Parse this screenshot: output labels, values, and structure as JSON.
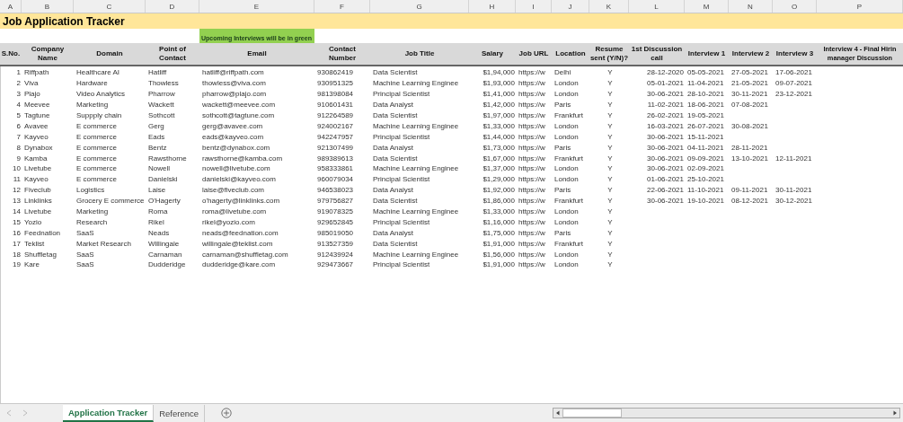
{
  "column_letters": [
    "A",
    "B",
    "C",
    "D",
    "E",
    "F",
    "G",
    "H",
    "I",
    "J",
    "K",
    "L",
    "M",
    "N",
    "O",
    "P"
  ],
  "title": "Job Application Tracker",
  "note": "Upcoming Interviews will be in green",
  "headers": [
    "S.No.",
    "Company\nName",
    "Domain",
    "Point of\nContact",
    "Email",
    "Contact\nNumber",
    "Job Title",
    "Salary",
    "Job URL",
    "Location",
    "Resume\nsent (Y/N)?",
    "1st Discussion\ncall",
    "Interview 1",
    "Interview 2",
    "Interview 3",
    "Interview 4 - Final Hirin\nmanager Discussion"
  ],
  "rows": [
    {
      "no": "1",
      "company": "Riffpath",
      "domain": "Healthcare AI",
      "contact": "Hatliff",
      "email": "hatliff@riffpath.com",
      "phone": "930862419",
      "title": "Data Scientist",
      "salary": "$1,94,000",
      "url": "https://w",
      "location": "Delhi",
      "resume": "Y",
      "dates": [
        "28-12-2020",
        "05-05-2021",
        "27-05-2021",
        "17-06-2021"
      ]
    },
    {
      "no": "2",
      "company": "Viva",
      "domain": "Hardware",
      "contact": "Thowless",
      "email": "thowless@viva.com",
      "phone": "930951325",
      "title": "Machine Learning Enginee",
      "salary": "$1,93,000",
      "url": "https://w",
      "location": "London",
      "resume": "Y",
      "dates": [
        "05-01-2021",
        "11-04-2021",
        "21-05-2021",
        "09-07-2021"
      ]
    },
    {
      "no": "3",
      "company": "Plajo",
      "domain": "Video Analytics",
      "contact": "Pharrow",
      "email": "pharrow@plajo.com",
      "phone": "981398084",
      "title": "Principal Scientist",
      "salary": "$1,41,000",
      "url": "https://w",
      "location": "London",
      "resume": "Y",
      "dates": [
        "30-06-2021",
        "28-10-2021",
        "30-11-2021",
        "23-12-2021"
      ]
    },
    {
      "no": "4",
      "company": "Meevee",
      "domain": "Marketing",
      "contact": "Wackett",
      "email": "wackett@meevee.com",
      "phone": "910601431",
      "title": "Data Analyst",
      "salary": "$1,42,000",
      "url": "https://w",
      "location": "Paris",
      "resume": "Y",
      "dates": [
        "11-02-2021",
        "18-06-2021",
        "07-08-2021"
      ]
    },
    {
      "no": "5",
      "company": "Tagtune",
      "domain": "Suppply chain",
      "contact": "Sothcott",
      "email": "sothcott@tagtune.com",
      "phone": "912264589",
      "title": "Data Scientist",
      "salary": "$1,97,000",
      "url": "https://w",
      "location": "Frankfurt",
      "resume": "Y",
      "dates": [
        "26-02-2021",
        "19-05-2021"
      ]
    },
    {
      "no": "6",
      "company": "Avavee",
      "domain": "E commerce",
      "contact": "Gerg",
      "email": "gerg@avavee.com",
      "phone": "924002167",
      "title": "Machine Learning Enginee",
      "salary": "$1,33,000",
      "url": "https://w",
      "location": "London",
      "resume": "Y",
      "dates": [
        "16-03-2021",
        "26-07-2021",
        "30-08-2021"
      ]
    },
    {
      "no": "7",
      "company": "Kayveo",
      "domain": "E commerce",
      "contact": "Eads",
      "email": "eads@kayveo.com",
      "phone": "942247957",
      "title": "Principal Scientist",
      "salary": "$1,44,000",
      "url": "https://w",
      "location": "London",
      "resume": "Y",
      "dates": [
        "30-06-2021",
        "15-11-2021"
      ]
    },
    {
      "no": "8",
      "company": "Dynabox",
      "domain": "E commerce",
      "contact": "Bentz",
      "email": "bentz@dynabox.com",
      "phone": "921307499",
      "title": "Data Analyst",
      "salary": "$1,73,000",
      "url": "https://w",
      "location": "Paris",
      "resume": "Y",
      "dates": [
        "30-06-2021",
        "04-11-2021",
        "28-11-2021"
      ]
    },
    {
      "no": "9",
      "company": "Kamba",
      "domain": "E commerce",
      "contact": "Rawsthorne",
      "email": "rawsthorne@kamba.com",
      "phone": "989389613",
      "title": "Data Scientist",
      "salary": "$1,67,000",
      "url": "https://w",
      "location": "Frankfurt",
      "resume": "Y",
      "dates": [
        "30-06-2021",
        "09-09-2021",
        "13-10-2021",
        "12-11-2021"
      ]
    },
    {
      "no": "10",
      "company": "Livetube",
      "domain": "E commerce",
      "contact": "Nowell",
      "email": "nowell@livetube.com",
      "phone": "958333861",
      "title": "Machine Learning Enginee",
      "salary": "$1,37,000",
      "url": "https://w",
      "location": "London",
      "resume": "Y",
      "dates": [
        "30-06-2021",
        "02-09-2021"
      ]
    },
    {
      "no": "11",
      "company": "Kayveo",
      "domain": "E commerce",
      "contact": "Danielski",
      "email": "danielski@kayveo.com",
      "phone": "960079034",
      "title": "Principal Scientist",
      "salary": "$1,29,000",
      "url": "https://w",
      "location": "London",
      "resume": "Y",
      "dates": [
        "01-06-2021",
        "25-10-2021"
      ]
    },
    {
      "no": "12",
      "company": "Fiveclub",
      "domain": "Logistics",
      "contact": "Laise",
      "email": "laise@fiveclub.com",
      "phone": "946538023",
      "title": "Data Analyst",
      "salary": "$1,92,000",
      "url": "https://w",
      "location": "Paris",
      "resume": "Y",
      "dates": [
        "22-06-2021",
        "11-10-2021",
        "09-11-2021",
        "30-11-2021"
      ]
    },
    {
      "no": "13",
      "company": "Linklinks",
      "domain": "Grocery E commerce",
      "contact": "O'Hagerty",
      "email": "o'hagerty@linklinks.com",
      "phone": "979756827",
      "title": "Data Scientist",
      "salary": "$1,86,000",
      "url": "https://w",
      "location": "Frankfurt",
      "resume": "Y",
      "dates": [
        "30-06-2021",
        "19-10-2021",
        "08-12-2021",
        "30-12-2021"
      ]
    },
    {
      "no": "14",
      "company": "Livetube",
      "domain": "Marketing",
      "contact": "Roma",
      "email": "roma@livetube.com",
      "phone": "919078325",
      "title": "Machine Learning Enginee",
      "salary": "$1,33,000",
      "url": "https://w",
      "location": "London",
      "resume": "Y",
      "dates": []
    },
    {
      "no": "15",
      "company": "Yozio",
      "domain": "Research",
      "contact": "Rikel",
      "email": "rikel@yozio.com",
      "phone": "929652845",
      "title": "Principal Scientist",
      "salary": "$1,16,000",
      "url": "https://w",
      "location": "London",
      "resume": "Y",
      "dates": []
    },
    {
      "no": "16",
      "company": "Feednation",
      "domain": "SaaS",
      "contact": "Neads",
      "email": "neads@feednation.com",
      "phone": "985019050",
      "title": "Data Analyst",
      "salary": "$1,75,000",
      "url": "https://w",
      "location": "Paris",
      "resume": "Y",
      "dates": []
    },
    {
      "no": "17",
      "company": "Teklist",
      "domain": "Market Research",
      "contact": "Willingale",
      "email": "willingale@teklist.com",
      "phone": "913527359",
      "title": "Data Scientist",
      "salary": "$1,91,000",
      "url": "https://w",
      "location": "Frankfurt",
      "resume": "Y",
      "dates": []
    },
    {
      "no": "18",
      "company": "Shuffletag",
      "domain": "SaaS",
      "contact": "Carnaman",
      "email": "carnaman@shuffletag.com",
      "phone": "912439924",
      "title": "Machine Learning Enginee",
      "salary": "$1,56,000",
      "url": "https://w",
      "location": "London",
      "resume": "Y",
      "dates": []
    },
    {
      "no": "19",
      "company": "Kare",
      "domain": "SaaS",
      "contact": "Dudderidge",
      "email": "dudderidge@kare.com",
      "phone": "929473667",
      "title": "Principal Scientist",
      "salary": "$1,91,000",
      "url": "https://w",
      "location": "London",
      "resume": "Y",
      "dates": []
    }
  ],
  "sheet_tabs": [
    {
      "label": "Application Tracker",
      "selected": true
    },
    {
      "label": "Reference",
      "selected": false
    }
  ]
}
